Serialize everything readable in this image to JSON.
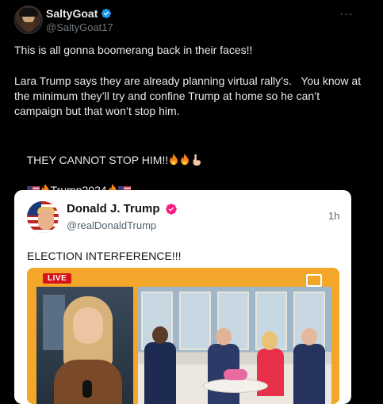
{
  "post": {
    "author_name": "SaltyGoat",
    "author_handle": "@SaltyGoat17",
    "more_label": "···",
    "line1": "This is all gonna boomerang back in their faces!!",
    "line2": "Lara Trump says they are already planning virtual rally’s.   You know at the minimum they’ll try and confine Trump at home so he can’t campaign but that won’t stop him.",
    "line3": "THEY CANNOT STOP HIM!!",
    "line3_emoji": "🔥🔥👇",
    "line4": "Trump2024"
  },
  "quote": {
    "author_name": "Donald J. Trump",
    "author_handle": "@realDonaldTrump",
    "time": "1h",
    "text": "ELECTION INTERFERENCE!!!",
    "live_label": "LIVE"
  },
  "colors": {
    "background": "#000000",
    "text": "#e7e9ea",
    "secondary": "#71767b",
    "verified_blue": "#1d9bf0",
    "verified_red": "#f91880",
    "live_red": "#d6131a"
  },
  "icons": {
    "verified": "verified-badge-icon",
    "more": "more-horizontal-icon",
    "fire": "fire-emoji-icon",
    "flag": "us-flag-emoji-icon",
    "point_down": "point-down-emoji-icon"
  }
}
